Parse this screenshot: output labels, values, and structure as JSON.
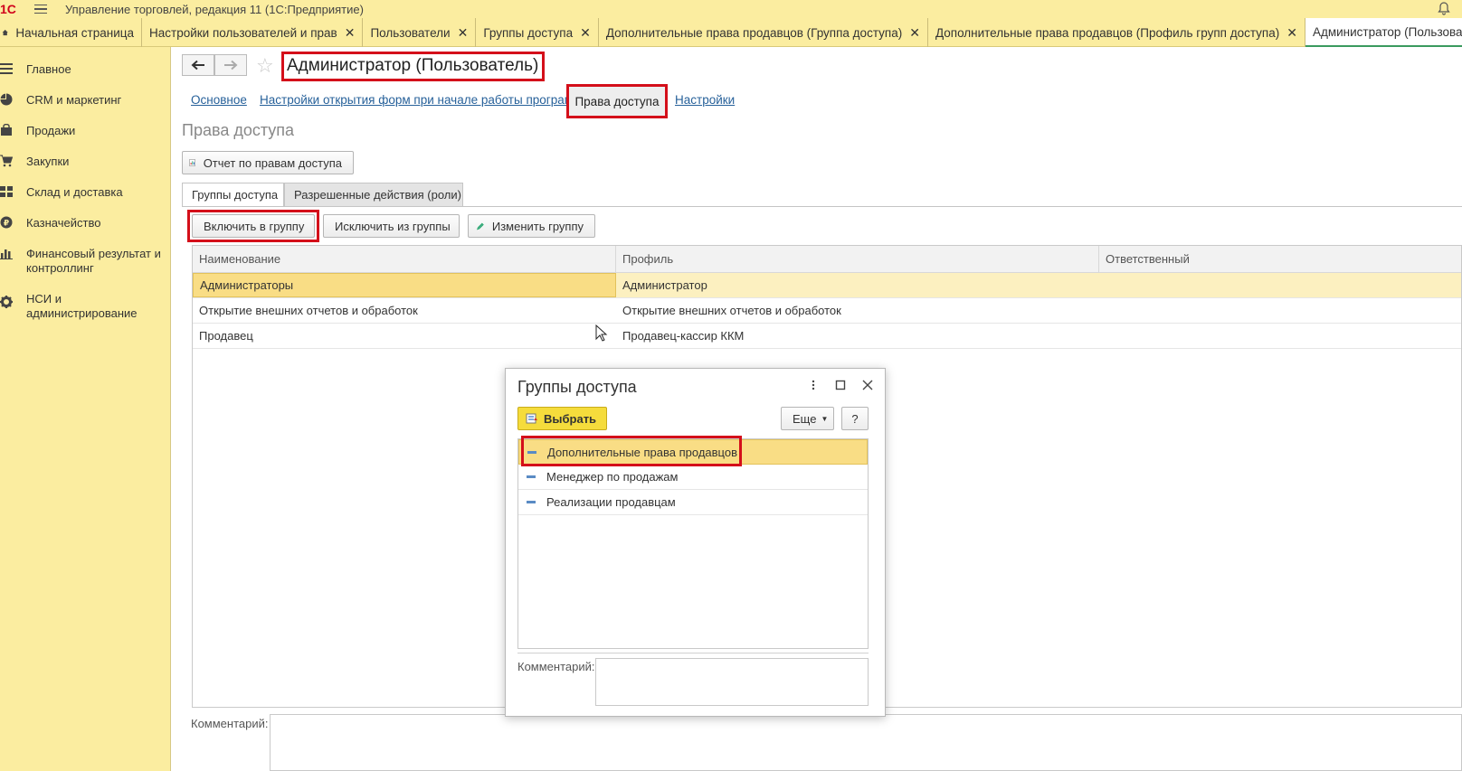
{
  "app": {
    "logo": "1С",
    "title": "Управление торговлей, редакция 11  (1С:Предприятие)"
  },
  "tabs": [
    {
      "label": "Начальная страница"
    },
    {
      "label": "Настройки пользователей и прав"
    },
    {
      "label": "Пользователи"
    },
    {
      "label": "Группы доступа"
    },
    {
      "label": "Дополнительные права продавцов (Группа доступа)"
    },
    {
      "label": "Дополнительные права продавцов (Профиль групп доступа)"
    },
    {
      "label": "Администратор (Пользователь)"
    }
  ],
  "sidebar": {
    "items": [
      {
        "label": "Главное",
        "icon": "menu-icon"
      },
      {
        "label": "CRM и маркетинг",
        "icon": "pie-chart-icon"
      },
      {
        "label": "Продажи",
        "icon": "bag-icon"
      },
      {
        "label": "Закупки",
        "icon": "cart-icon"
      },
      {
        "label": "Склад и доставка",
        "icon": "warehouse-icon"
      },
      {
        "label": "Казначейство",
        "icon": "ruble-icon"
      },
      {
        "label": "Финансовый результат и контроллинг",
        "icon": "bar-chart-icon"
      },
      {
        "label": "НСИ и администрирование",
        "icon": "gear-icon"
      }
    ]
  },
  "form": {
    "title": "Администратор (Пользователь)",
    "links": [
      "Основное",
      "Настройки открытия форм при начале работы программы",
      "Права доступа",
      "Настройки"
    ],
    "section_title": "Права доступа",
    "report_button": "Отчет по правам доступа",
    "subtabs": [
      "Группы доступа",
      "Разрешенные действия (роли)"
    ],
    "buttons": {
      "include": "Включить в группу",
      "exclude": "Исключить из группы",
      "edit": "Изменить группу"
    },
    "table": {
      "columns": [
        "Наименование",
        "Профиль",
        "Ответственный"
      ],
      "rows": [
        {
          "name": "Администраторы",
          "profile": "Администратор",
          "responsible": ""
        },
        {
          "name": "Открытие внешних отчетов и обработок",
          "profile": "Открытие внешних отчетов и обработок",
          "responsible": ""
        },
        {
          "name": "Продавец",
          "profile": "Продавец-кассир ККМ",
          "responsible": ""
        }
      ]
    },
    "comment_label": "Комментарий:"
  },
  "dialog": {
    "title": "Группы доступа",
    "select_button": "Выбрать",
    "more_button": "Еще",
    "help_button": "?",
    "items": [
      "Дополнительные права продавцов",
      "Менеджер по продажам",
      "Реализации продавцам"
    ],
    "comment_label": "Комментарий:"
  },
  "colors": {
    "panel_bg": "#fbeda0",
    "highlight_red": "#d40f1a",
    "selection": "#f9dd85",
    "link": "#27619a",
    "primary_button": "#f5dc3c"
  }
}
